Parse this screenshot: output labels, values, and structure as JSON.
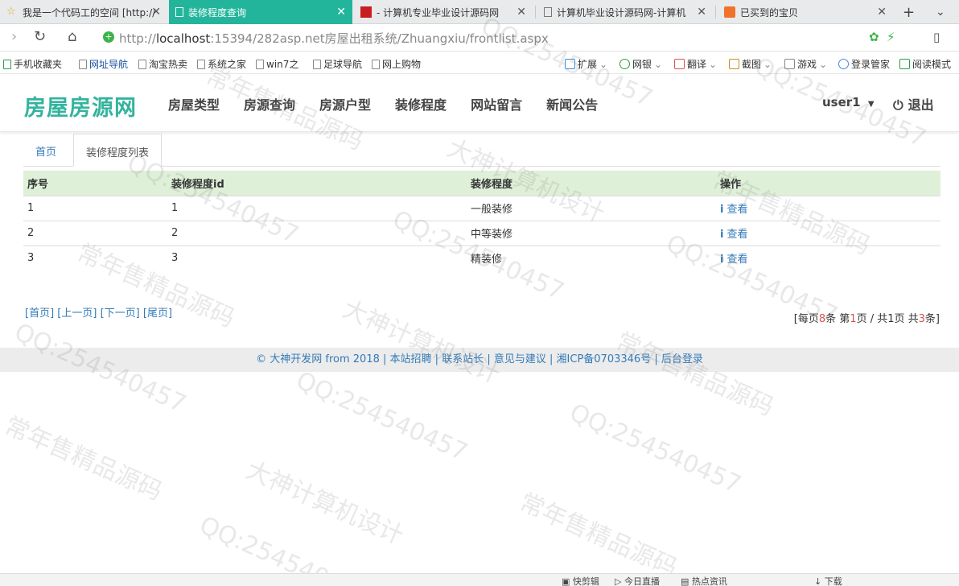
{
  "browser": {
    "tabs": [
      {
        "label": "我是一个代码工的空间 [http://",
        "active": false,
        "icon": "star-icon"
      },
      {
        "label": "装修程度查询",
        "active": true,
        "icon": "page-icon"
      },
      {
        "label": "- 计算机专业毕业设计源码网",
        "active": false,
        "icon": "site-icon"
      },
      {
        "label": "计算机毕业设计源码网-计算机",
        "active": false,
        "icon": "page-icon"
      },
      {
        "label": "已买到的宝贝",
        "active": false,
        "icon": "taobao-icon"
      }
    ],
    "url": {
      "scheme": "http://",
      "host": "localhost",
      "rest": ":15394/282asp.net房屋出租系统/Zhuangxiu/frontlist.aspx"
    },
    "bookmarks_left": [
      "手机收藏夹",
      "网址导航",
      "淘宝热卖",
      "系统之家",
      "win7之",
      "足球导航",
      "网上购物"
    ],
    "bookmarks_right": [
      "扩展",
      "网银",
      "翻译",
      "截图",
      "游戏",
      "登录管家",
      "阅读模式"
    ]
  },
  "site": {
    "logo": "房屋房源网",
    "nav": [
      "房屋类型",
      "房源查询",
      "房源户型",
      "装修程度",
      "网站留言",
      "新闻公告"
    ],
    "user": "user1",
    "logout": "退出"
  },
  "content_tabs": [
    "首页",
    "装修程度列表"
  ],
  "table": {
    "headers": [
      "序号",
      "装修程度id",
      "装修程度",
      "操作"
    ],
    "rows": [
      {
        "seq": "1",
        "id": "1",
        "name": "一般装修",
        "action": "查看"
      },
      {
        "seq": "2",
        "id": "2",
        "name": "中等装修",
        "action": "查看"
      },
      {
        "seq": "3",
        "id": "3",
        "name": "精装修",
        "action": "查看"
      }
    ]
  },
  "pager": {
    "first": "[首页]",
    "prev": "[上一页]",
    "next": "[下一页]",
    "last": "[尾页]"
  },
  "pageinfo": {
    "prefix": "[每页",
    "per_page": "8",
    "mid1": "条 第",
    "page": "1",
    "mid2": "页 / 共",
    "pages": "1",
    "mid3": "页 共",
    "total": "3",
    "suffix": "条]"
  },
  "footer": [
    "© 大神开发网 from 2018",
    "本站招聘",
    "联系站长",
    "意见与建议",
    "湘ICP备0703346号",
    "后台登录"
  ],
  "statusbar": [
    "快剪辑",
    "今日直播",
    "热点资讯",
    "下载"
  ],
  "watermarks": [
    "QQ:254540457",
    "常年售精品源码",
    "大神计算机设计"
  ],
  "colors": {
    "accent": "#23b59b",
    "logo": "#34b39e",
    "link": "#337ab7",
    "table_header": "#dff0d8",
    "highlight": "#d9534f"
  }
}
